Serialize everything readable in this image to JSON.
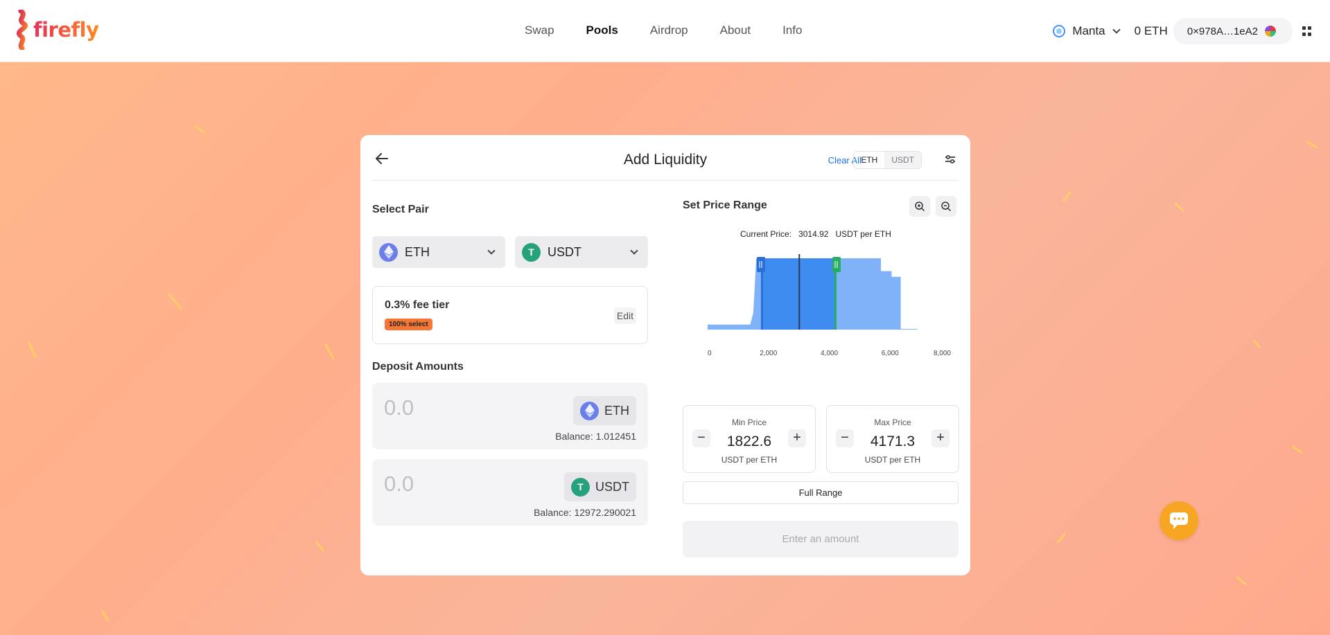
{
  "header": {
    "logo_text": "firefly",
    "nav": [
      "Swap",
      "Pools",
      "Airdrop",
      "About",
      "Info"
    ],
    "active_nav": "Pools",
    "network": "Manta",
    "eth_balance": "0 ETH",
    "wallet_address": "0×978A…1eA2"
  },
  "card": {
    "title": "Add Liquidity",
    "clear_all": "Clear All",
    "token_toggle": [
      "ETH",
      "USDT"
    ],
    "select_pair_label": "Select Pair",
    "token_a": "ETH",
    "token_b": "USDT",
    "fee": {
      "title": "0.3% fee tier",
      "badge": "100% select",
      "edit": "Edit"
    },
    "deposit_label": "Deposit Amounts",
    "deposits": [
      {
        "placeholder": "0.0",
        "token": "ETH",
        "balance": "Balance: 1.012451"
      },
      {
        "placeholder": "0.0",
        "token": "USDT",
        "balance": "Balance: 12972.290021"
      }
    ],
    "price_range_label": "Set Price Range",
    "current_price_label": "Current Price:",
    "current_price_value": "3014.92",
    "current_price_unit": "USDT per ETH",
    "min_price": {
      "label": "Min Price",
      "value": "1822.6",
      "unit": "USDT per ETH"
    },
    "max_price": {
      "label": "Max Price",
      "value": "4171.3",
      "unit": "USDT per ETH"
    },
    "full_range": "Full Range",
    "enter_amount": "Enter an amount"
  },
  "colors": {
    "accent_blue": "#1a73e8",
    "range_blue": "#3f8cf0",
    "liquidity_light": "#7fb2f8",
    "min_handle": "#2a6fd6",
    "max_handle": "#27ae60",
    "fee_badge": "#f47735",
    "chat_button": "#f6a623"
  },
  "chart_data": {
    "type": "area",
    "x_ticks": [
      "0",
      "2,000",
      "4,000",
      "6,000",
      "8,000"
    ],
    "xlim": [
      0,
      8000
    ],
    "current_price": 3014.92,
    "min_price": 1822.6,
    "max_price": 4171.3,
    "liquidity": [
      {
        "x": 0,
        "y": 0.07
      },
      {
        "x": 1400,
        "y": 0.07
      },
      {
        "x": 1500,
        "y": 0.23
      },
      {
        "x": 1600,
        "y": 1.0
      },
      {
        "x": 5700,
        "y": 1.0
      },
      {
        "x": 5700,
        "y": 0.82
      },
      {
        "x": 6050,
        "y": 0.82
      },
      {
        "x": 6050,
        "y": 0.74
      },
      {
        "x": 6350,
        "y": 0.74
      },
      {
        "x": 6350,
        "y": 0.01
      },
      {
        "x": 6900,
        "y": 0.01
      }
    ]
  }
}
